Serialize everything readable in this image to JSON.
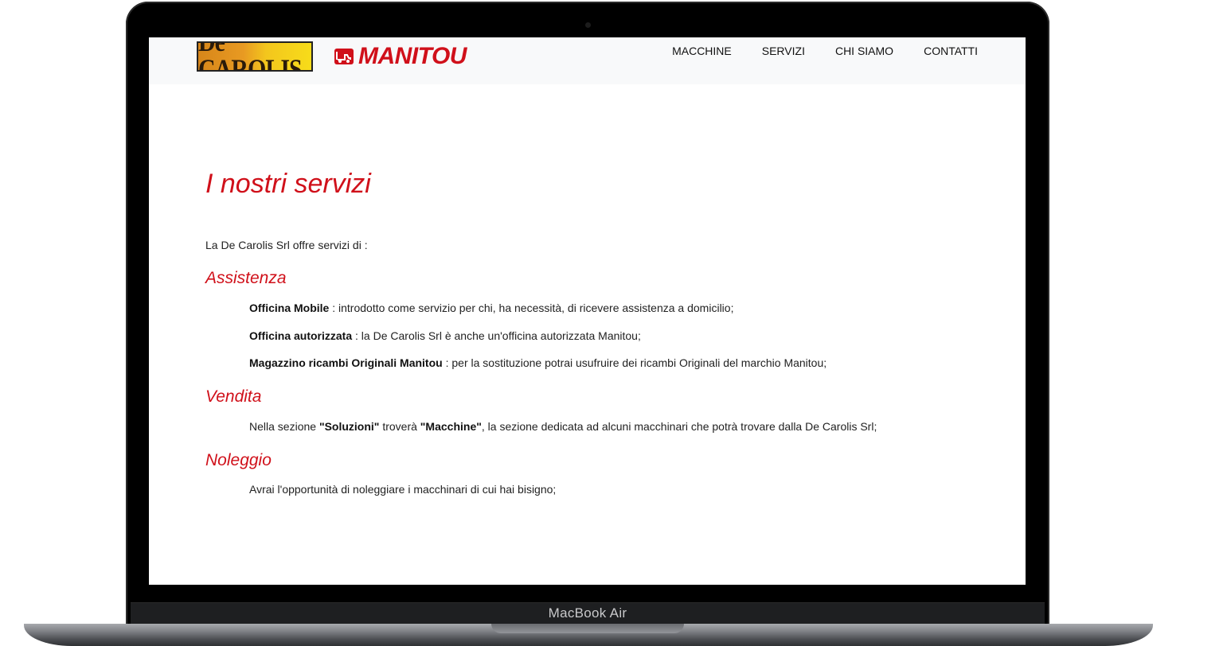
{
  "device": {
    "label": "MacBook Air"
  },
  "brand": {
    "logo_left": "De CAROLIS",
    "logo_right": "MANITOU"
  },
  "nav": {
    "items": [
      "MACCHINE",
      "SERVIZI",
      "CHI SIAMO",
      "CONTATTI"
    ]
  },
  "page": {
    "title": "I nostri servizi",
    "intro": "La De Carolis Srl offre servizi di :",
    "sections": [
      {
        "heading": "Assistenza",
        "items": [
          {
            "bold": "Officina Mobile",
            "text": " : introdotto come servizio per chi, ha necessità, di ricevere assistenza a domicilio;"
          },
          {
            "bold": "Officina autorizzata",
            "text": " : la De Carolis Srl è anche un'officina autorizzata Manitou;"
          },
          {
            "bold": "Magazzino ricambi Originali Manitou",
            "text": " : per la sostituzione potrai usufruire dei ricambi Originali del marchio Manitou;"
          }
        ]
      },
      {
        "heading": "Vendita",
        "line": {
          "pre": "Nella sezione ",
          "b1": "\"Soluzioni\"",
          "mid": " troverà ",
          "b2": "\"Macchine\"",
          "post": ", la sezione dedicata ad alcuni macchinari che potrà trovare dalla De Carolis Srl;"
        }
      },
      {
        "heading": "Noleggio",
        "text": "Avrai l'opportunità di noleggiare i macchinari di cui hai bisigno;"
      }
    ]
  },
  "colors": {
    "accent": "#d0101a",
    "navbar_bg": "#f8f9fa"
  }
}
